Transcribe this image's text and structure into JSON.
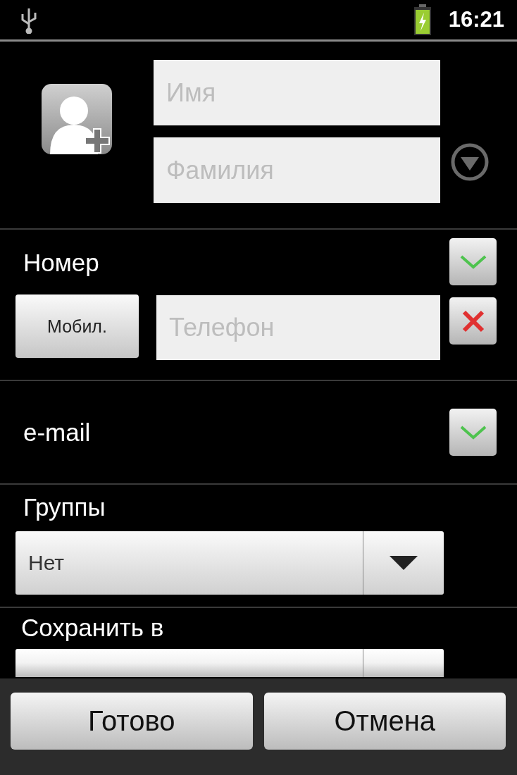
{
  "status_bar": {
    "time": "16:21"
  },
  "name": {
    "fields": [
      {
        "placeholder": "Имя"
      },
      {
        "placeholder": "Фамилия"
      }
    ]
  },
  "phone": {
    "label": "Номер",
    "type_button": "Мобил.",
    "field": {
      "placeholder": "Телефон"
    }
  },
  "email": {
    "label": "e-mail"
  },
  "groups": {
    "label": "Группы",
    "value": "Нет"
  },
  "save_to": {
    "label": "Сохранить в"
  },
  "buttons": [
    "Готово",
    "Отмена"
  ]
}
